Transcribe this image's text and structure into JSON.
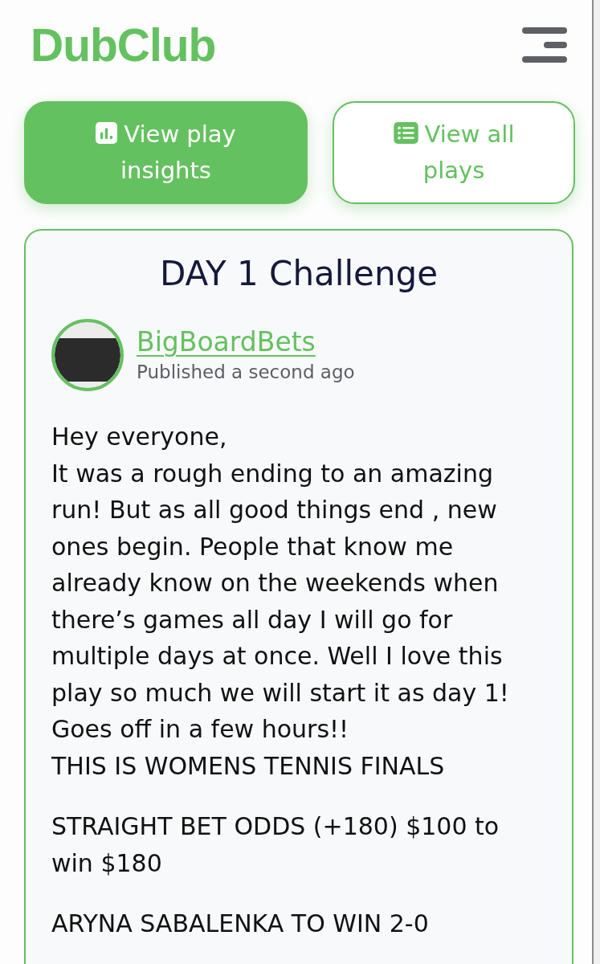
{
  "header": {
    "logo": "DubClub"
  },
  "actions": [
    {
      "label": "View play insights",
      "kind": "filled"
    },
    {
      "label": "View all plays",
      "kind": "outline"
    }
  ],
  "post": {
    "title": "DAY 1 Challenge",
    "author": "BigBoardBets",
    "published": "Published a second ago",
    "body": [
      [
        "Hey everyone,",
        "It was a rough ending to an amazing run! But as all good things end , new ones begin. People that know me already know on the weekends when there’s games all day I will go for multiple days at once. Well I love this play so much we will start it as day 1!",
        "Goes off in a few hours!!",
        "THIS IS WOMENS TENNIS FINALS"
      ],
      [
        "STRAIGHT BET ODDS (+180) $100 to win $180"
      ],
      [
        "ARYNA SABALENKA TO WIN 2-0"
      ]
    ]
  }
}
